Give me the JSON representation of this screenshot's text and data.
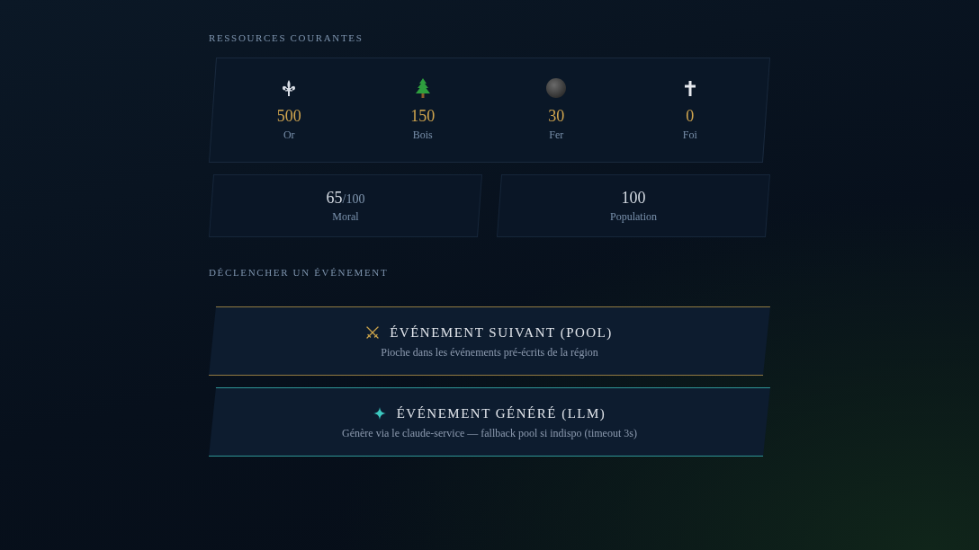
{
  "resources": {
    "title": "RESSOURCES COURANTES",
    "items": [
      {
        "value": "500",
        "label": "Or"
      },
      {
        "value": "150",
        "label": "Bois"
      },
      {
        "value": "30",
        "label": "Fer"
      },
      {
        "value": "0",
        "label": "Foi"
      }
    ]
  },
  "stats": [
    {
      "value": "65",
      "max": "/100",
      "label": "Moral"
    },
    {
      "value": "100",
      "label": "Population"
    }
  ],
  "events": {
    "title": "DÉCLENCHER UN ÉVÉNEMENT",
    "actions": [
      {
        "title": "ÉVÉNEMENT SUIVANT (POOL)",
        "description": "Pioche dans les événements pré-écrits de la région",
        "color": "#c9a24a"
      },
      {
        "title": "ÉVÉNEMENT GÉNÉRÉ (LLM)",
        "description": "Génère via le claude-service — fallback pool si indispo (timeout 3s)",
        "color": "#3cc8c0"
      }
    ]
  }
}
